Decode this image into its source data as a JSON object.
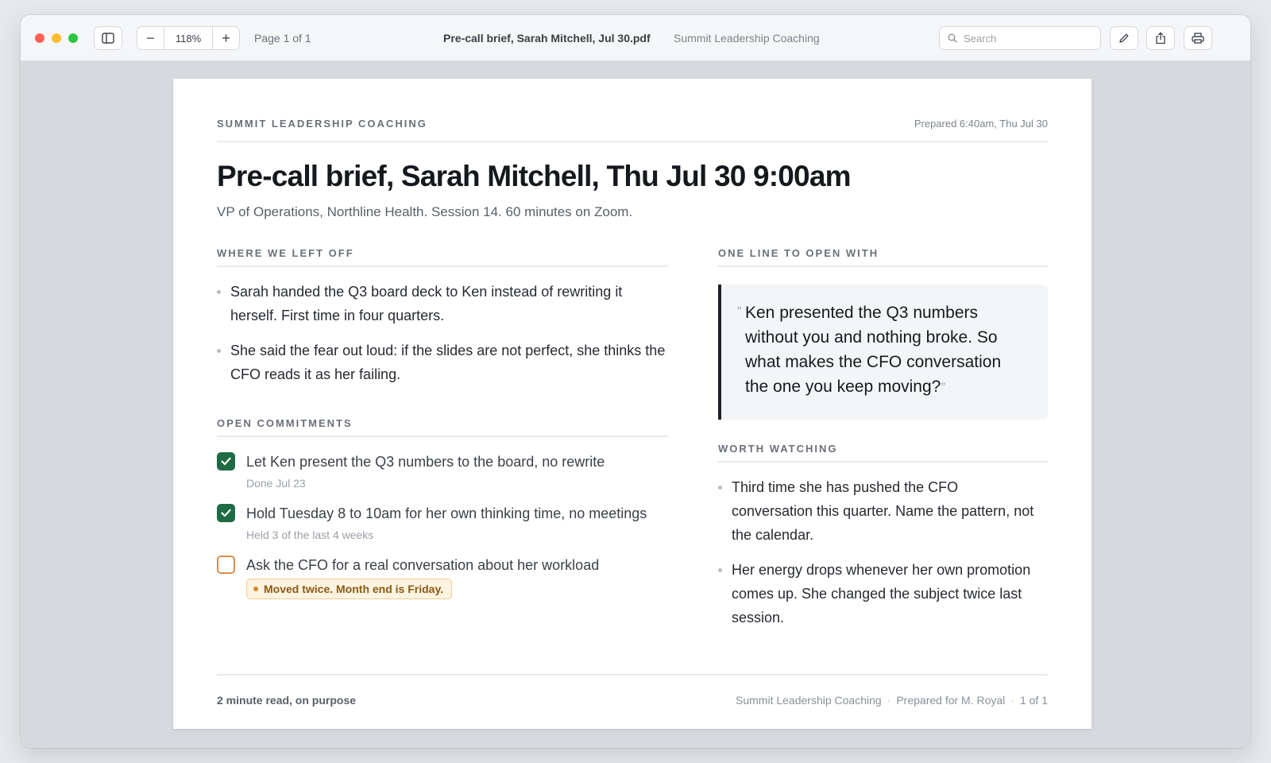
{
  "toolbar": {
    "zoom_value": "118%",
    "zoom_out": "−",
    "zoom_in": "+",
    "page_info": "Page 1 of 1",
    "file_name": "Pre-call brief, Sarah Mitchell, Jul 30.pdf",
    "file_org": "Summit Leadership Coaching",
    "search_placeholder": "Search",
    "icons": [
      "sidebar-icon",
      "search-icon",
      "pencil-icon",
      "share-icon",
      "printer-icon"
    ]
  },
  "doc": {
    "org": "SUMMIT LEADERSHIP COACHING",
    "prepared": "Prepared 6:40am, Thu Jul 30",
    "title": "Pre-call brief, Sarah Mitchell, Thu Jul 30 9:00am",
    "subtitle": "VP of Operations, Northline Health. Session 14. 60 minutes on Zoom.",
    "left_off": {
      "heading": "WHERE WE LEFT OFF",
      "items": [
        "Sarah handed the Q3 board deck to Ken instead of rewriting it herself. First time in four quarters.",
        "She said the fear out loud: if the slides are not perfect, she thinks the CFO reads it as her failing."
      ]
    },
    "commitments": {
      "heading": "OPEN COMMITMENTS",
      "items": [
        {
          "text": "Let Ken present the Q3 numbers to the board, no rewrite",
          "note": "Done Jul 23",
          "status": "done"
        },
        {
          "text": "Hold Tuesday 8 to 10am for her own thinking time, no meetings",
          "note": "Held 3 of the last 4 weeks",
          "status": "done"
        },
        {
          "text": "Ask the CFO for a real conversation about her workload",
          "note": "Moved twice. Month end is Friday.",
          "status": "open"
        }
      ]
    },
    "open_line": {
      "heading": "ONE LINE TO OPEN WITH",
      "quote": "Ken presented the Q3 numbers without you and nothing broke. So what makes the CFO conversation the one you keep moving?"
    },
    "watching": {
      "heading": "WORTH WATCHING",
      "items": [
        "Third time she has pushed the CFO conversation this quarter. Name the pattern, not the calendar.",
        "Her energy drops whenever her own promotion comes up. She changed the subject twice last session."
      ]
    },
    "footer": {
      "left": "2 minute read, on purpose",
      "org": "Summit Leadership Coaching",
      "prepared_for": "Prepared for M. Royal",
      "page": "1 of 1",
      "separator": "·"
    }
  },
  "colors": {
    "check_done": "#1f6b45",
    "check_open_border": "#d98f4a",
    "badge_bg": "#fdf3e1",
    "badge_text": "#8a5a14",
    "quote_bar": "#1d2127"
  }
}
